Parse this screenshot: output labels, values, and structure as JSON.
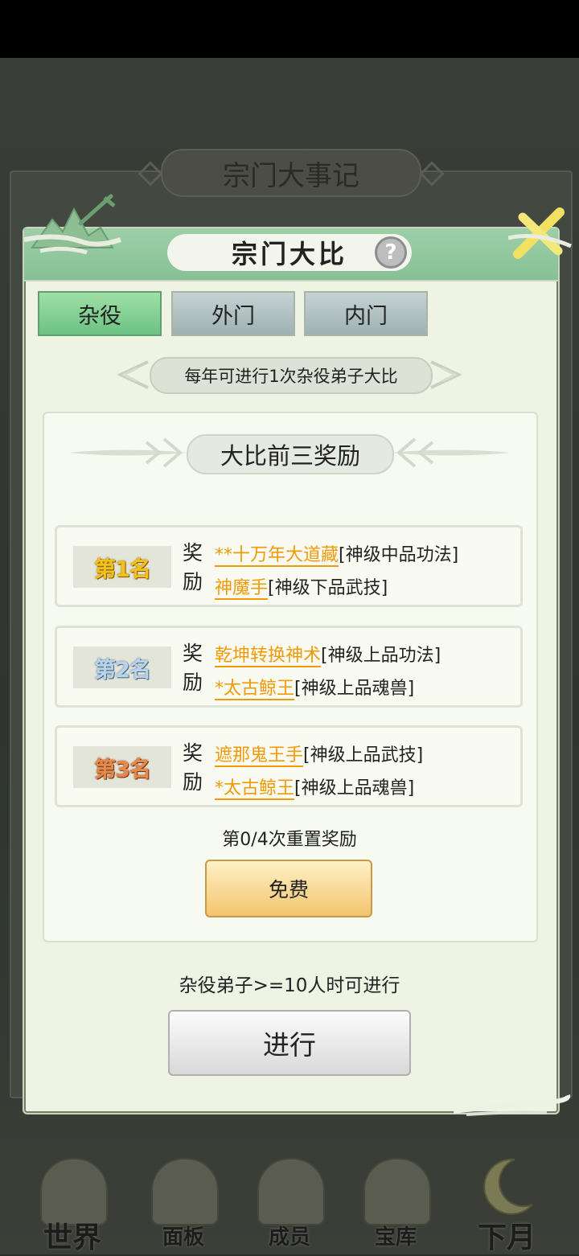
{
  "background": {
    "title": "宗门大事记"
  },
  "modal": {
    "title": "宗门大比",
    "help_icon": "?",
    "close_icon": "close-icon"
  },
  "tabs": [
    {
      "label": "杂役",
      "active": true
    },
    {
      "label": "外门",
      "active": false
    },
    {
      "label": "内门",
      "active": false
    }
  ],
  "notice": "每年可进行1次杂役弟子大比",
  "rewards": {
    "section_title": "大比前三奖励",
    "label_top": "奖",
    "label_bottom": "励",
    "ranks": [
      {
        "rank": "第1名",
        "items": [
          {
            "name": "**十万年大道藏",
            "type": "[神级中品功法]"
          },
          {
            "name": "神魔手",
            "type": "[神级下品武技]"
          }
        ]
      },
      {
        "rank": "第2名",
        "items": [
          {
            "name": "乾坤转换神术",
            "type": "[神级上品功法]"
          },
          {
            "name": "*太古鲸王",
            "type": "[神级上品魂兽]"
          }
        ]
      },
      {
        "rank": "第3名",
        "items": [
          {
            "name": "遮那鬼王手",
            "type": "[神级上品武技]"
          },
          {
            "name": "*太古鲸王",
            "type": "[神级上品魂兽]"
          }
        ]
      }
    ],
    "reset_text": "第0/4次重置奖励",
    "free_button": "免费"
  },
  "condition_text": "杂役弟子>=10人时可进行",
  "go_button": "进行",
  "bottom_nav": [
    {
      "label": "世界",
      "icon": "palace-icon"
    },
    {
      "label": "面板",
      "icon": "hall-icon"
    },
    {
      "label": "成员",
      "icon": "member-icon"
    },
    {
      "label": "宝库",
      "icon": "treasury-icon"
    },
    {
      "label": "下月",
      "icon": "moon-icon"
    }
  ],
  "colors": {
    "header_green": "#88c095",
    "active_tab": "#6cc283",
    "reward_item": "#f19a08",
    "gold_rank": "#f2c21c",
    "silver_rank": "#b9d3ea",
    "bronze_rank": "#e58a4a"
  }
}
